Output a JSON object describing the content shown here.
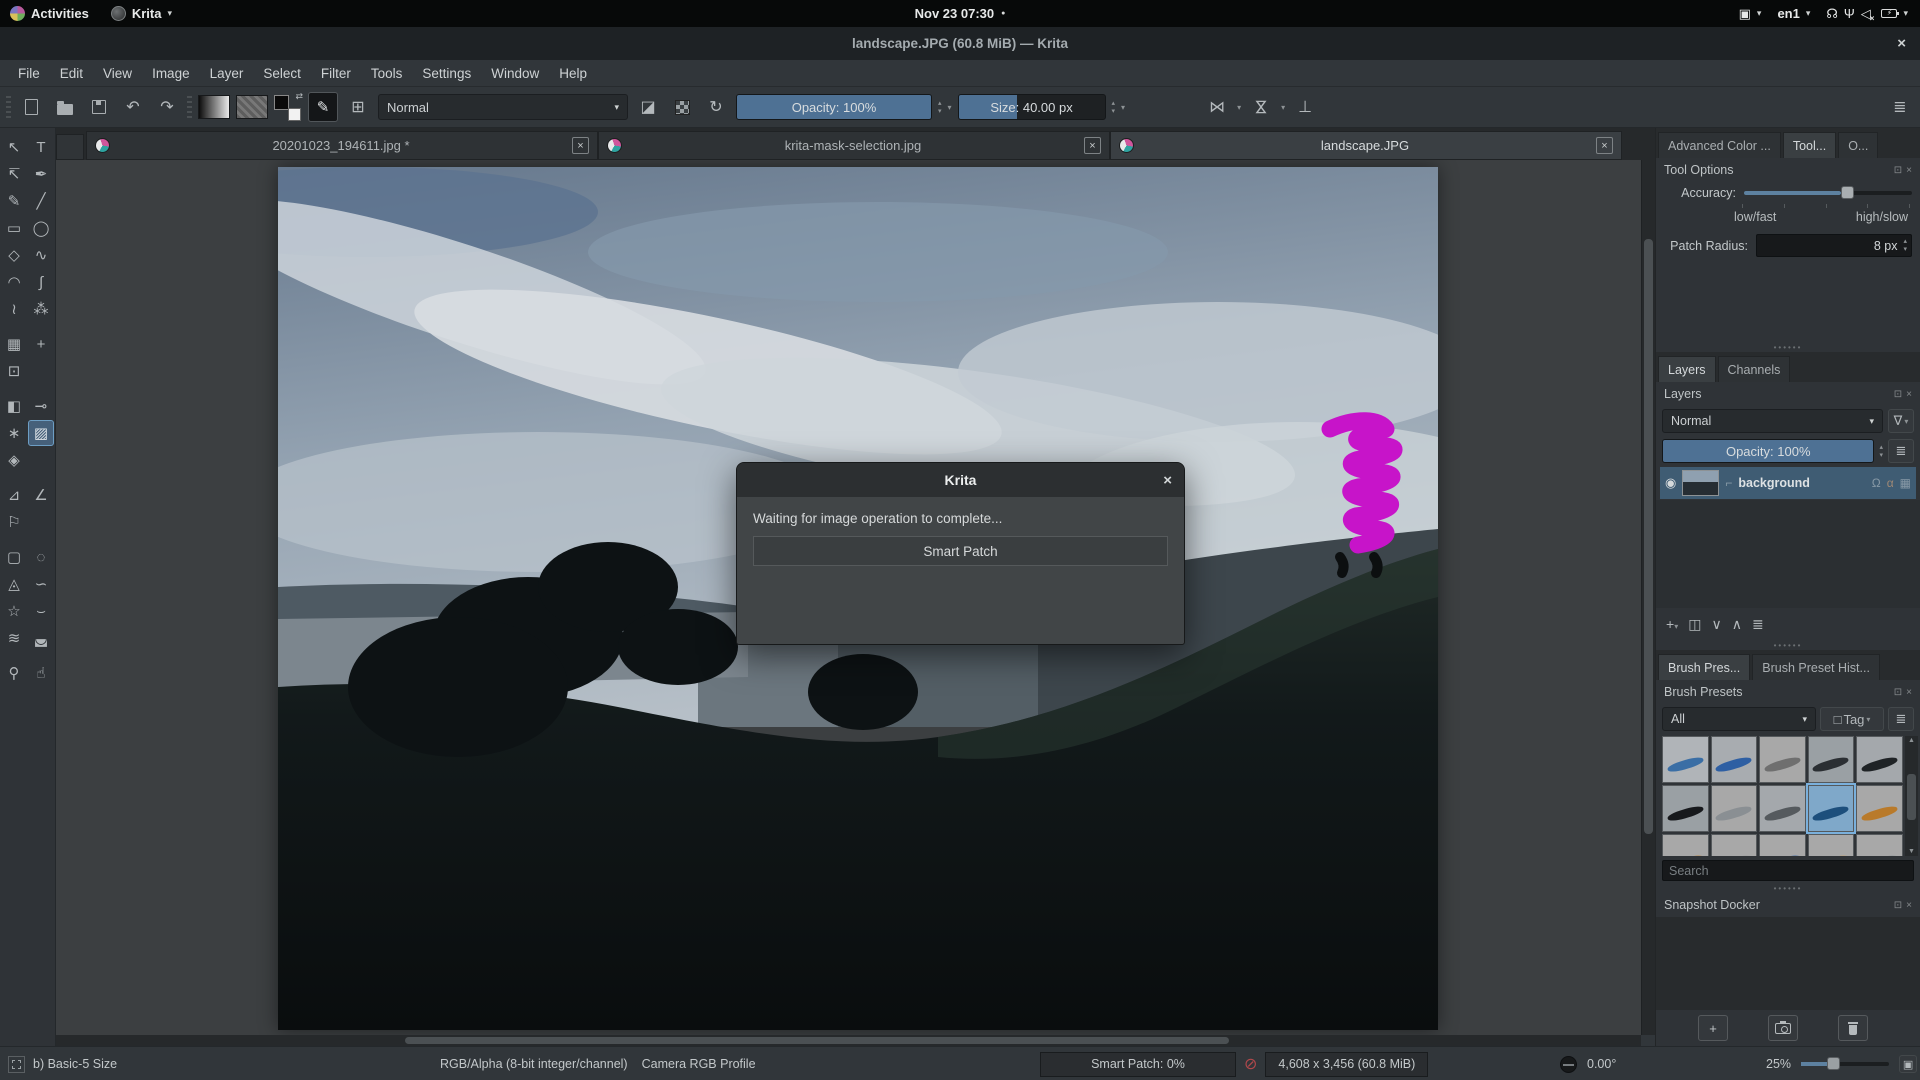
{
  "gnome_bar": {
    "activities_label": "Activities",
    "app_menu_label": "Krita",
    "clock": "Nov 23 07:30",
    "keyboard_layout": "en1"
  },
  "title_bar": {
    "title": "landscape.JPG (60.8 MiB)  —  Krita"
  },
  "menu_bar": {
    "items": [
      "File",
      "Edit",
      "View",
      "Image",
      "Layer",
      "Select",
      "Filter",
      "Tools",
      "Settings",
      "Window",
      "Help"
    ]
  },
  "toolbar": {
    "blend_mode": "Normal",
    "opacity_label": "Opacity: 100%",
    "size_label": "Size: 40.00 px"
  },
  "tabs": [
    {
      "label": "20201023_194611.jpg *"
    },
    {
      "label": "krita-mask-selection.jpg"
    },
    {
      "label": "landscape.JPG"
    }
  ],
  "toolbox": {
    "groups": [
      [
        {
          "name": "transform-select",
          "glyph": "↖"
        },
        {
          "name": "text",
          "glyph": "T"
        },
        {
          "name": "edit-shapes",
          "glyph": "↸"
        },
        {
          "name": "calligraphy",
          "glyph": "✒"
        },
        {
          "name": "freehand-brush",
          "glyph": "✎"
        },
        {
          "name": "line",
          "glyph": "╱"
        },
        {
          "name": "rectangle",
          "glyph": "▭"
        },
        {
          "name": "ellipse",
          "glyph": "◯"
        },
        {
          "name": "polygon",
          "glyph": "◇"
        },
        {
          "name": "polyline",
          "glyph": "∿"
        },
        {
          "name": "bezier-curve",
          "glyph": "◠"
        },
        {
          "name": "freehand-path",
          "glyph": "∫"
        },
        {
          "name": "dynamic-brush",
          "glyph": "≀"
        },
        {
          "name": "multibrush",
          "glyph": "⁂"
        }
      ],
      [
        {
          "name": "transform",
          "glyph": "▦"
        },
        {
          "name": "move",
          "glyph": "+"
        },
        {
          "name": "crop",
          "glyph": "⊡"
        },
        null
      ],
      [
        {
          "name": "gradient",
          "glyph": "◧"
        },
        {
          "name": "color-sampler",
          "glyph": "⊸"
        },
        {
          "name": "colorize-mask",
          "glyph": "∗"
        },
        {
          "name": "smart-patch",
          "glyph": "▨",
          "selected": true
        },
        {
          "name": "fill",
          "glyph": "◈"
        },
        null
      ],
      [
        {
          "name": "assistants",
          "glyph": "⊿"
        },
        {
          "name": "measure",
          "glyph": "∠"
        },
        {
          "name": "reference-images",
          "glyph": "⚐"
        },
        null
      ],
      [
        {
          "name": "rectangular-selection",
          "glyph": "▢"
        },
        {
          "name": "elliptical-selection",
          "glyph": "◌"
        },
        {
          "name": "polygonal-selection",
          "glyph": "◬"
        },
        {
          "name": "freehand-selection",
          "glyph": "∽"
        },
        {
          "name": "similar-color-selection",
          "glyph": "☆"
        },
        {
          "name": "bezier-selection",
          "glyph": "⌣"
        },
        {
          "name": "magnetic-selection",
          "glyph": "≋"
        },
        {
          "name": "enclose-fill-selection",
          "glyph": "◛"
        }
      ],
      [
        {
          "name": "zoom",
          "glyph": "⚲"
        },
        {
          "name": "pan",
          "glyph": "☝"
        }
      ]
    ]
  },
  "right_panel": {
    "top_tabs": [
      {
        "label": "Advanced Color ...",
        "active": false
      },
      {
        "label": "Tool...",
        "active": true
      },
      {
        "label": "O...",
        "active": false
      }
    ],
    "tool_options": {
      "title": "Tool Options",
      "accuracy_label": "Accuracy:",
      "scale_left": "low/fast",
      "scale_right": "high/slow",
      "patch_radius_label": "Patch Radius:",
      "patch_radius_value": "8 px"
    },
    "layers": {
      "tab_layers": "Layers",
      "tab_channels": "Channels",
      "title": "Layers",
      "blend_mode": "Normal",
      "opacity_label": "Opacity:  100%",
      "layer_name": "background"
    },
    "brush": {
      "tab_presets": "Brush Pres...",
      "tab_history": "Brush Preset Hist...",
      "title": "Brush Presets",
      "filter_value": "All",
      "tag_label": "Tag",
      "search_placeholder": "Search",
      "tiles": [
        {
          "bg": "#b0b4b8",
          "accent": "#3a6ea5"
        },
        {
          "bg": "#a8acb0",
          "accent": "#2e5fa3"
        },
        {
          "bg": "#a8a8a8",
          "accent": "#6f6f6f"
        },
        {
          "bg": "#9aa0a4",
          "accent": "#2b2f33"
        },
        {
          "bg": "#a4a8ac",
          "accent": "#1f2326"
        },
        {
          "bg": "#9aa0a4",
          "accent": "#17191c"
        },
        {
          "bg": "#a8a8a8",
          "accent": "#8a8f93"
        },
        {
          "bg": "#a4a8ac",
          "accent": "#555a5e"
        },
        {
          "bg": "#7fa8c9",
          "accent": "#1d4f7c",
          "selected": true
        },
        {
          "bg": "#a8a8a8",
          "accent": "#b97a2a"
        },
        {
          "bg": "#a8a8a8",
          "accent": "#c08030"
        },
        {
          "bg": "#a8a8a8",
          "accent": "#9a9a9a"
        },
        {
          "bg": "#a8a8a8",
          "accent": "#2e5fa3"
        },
        {
          "bg": "#a8a8a8",
          "accent": "#caa36a"
        },
        {
          "bg": "#a8a8a8",
          "accent": "#8f9499"
        }
      ]
    },
    "snapshot": {
      "title": "Snapshot Docker"
    }
  },
  "statusbar": {
    "brush_preset": "b) Basic-5 Size",
    "color_mode": "RGB/Alpha (8-bit integer/channel)",
    "color_profile": "Camera RGB Profile",
    "progress_label": "Smart Patch: 0%",
    "image_size": "4,608 x 3,456 (60.8 MiB)",
    "rotation": "0.00°",
    "zoom_level": "25%"
  },
  "dialog": {
    "title": "Krita",
    "message": "Waiting for image operation to complete...",
    "progress_label": "Smart Patch"
  },
  "icons": {
    "caret_down": "▾",
    "caret_up": "▴",
    "close": "×",
    "undo": "↶",
    "redo": "↷",
    "reload": "↻",
    "eraser": "◪",
    "preset_grid": "⊞",
    "mirror": "⋈",
    "wrap": "⊥",
    "toolbar_menu": "≣",
    "swap": "⇄",
    "clipboard": "▣",
    "wifi": "☊",
    "microphone": "Ψ",
    "volume": "◁",
    "mute_x": "×",
    "bolt": "⚡",
    "notif_dot": "●",
    "float": "⊡",
    "dock_close": "×",
    "eye": "◉",
    "funnel": "∇",
    "list": "≣",
    "add": "+",
    "duplicate": "◫",
    "arrow_down": "∨",
    "arrow_up": "∧",
    "properties": "≣",
    "lock": "Ω",
    "alpha": "α",
    "checker": "▦",
    "layer_badge": "⌐",
    "checkbox": "□",
    "cancel": "⊘",
    "canvas_only": "▣",
    "scroll_up": "▲",
    "scroll_down": "▼"
  },
  "colors": {
    "accent_blue": "#4e7194",
    "selection_blue": "#3f5c73",
    "scribble_magenta": "#c714c9"
  }
}
